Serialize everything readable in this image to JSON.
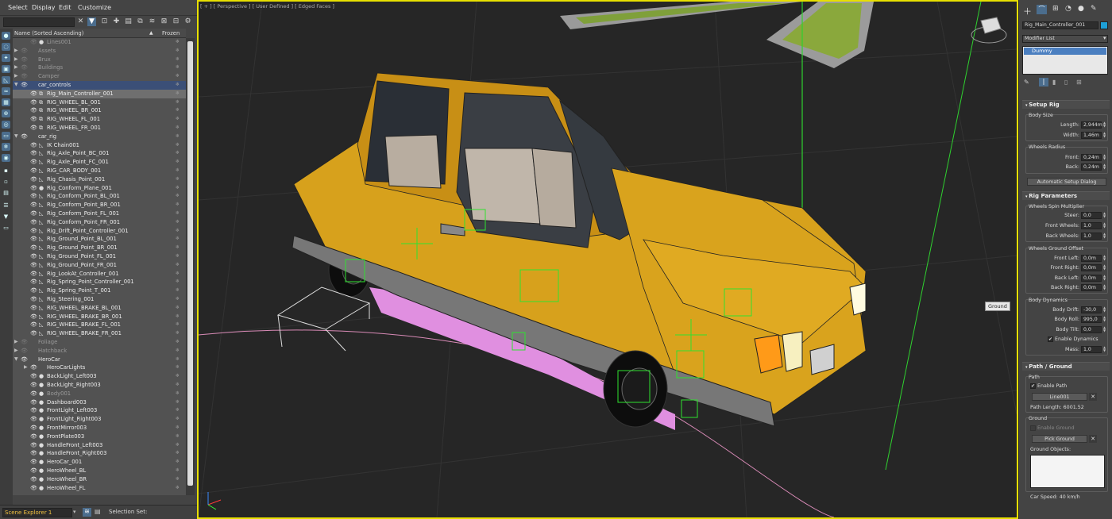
{
  "menubar": {
    "items": [
      "Select",
      "Display",
      "Edit",
      "Customize"
    ]
  },
  "scene_explorer": {
    "header": {
      "name_col": "Name (Sorted Ascending)",
      "frozen_col": "Frozen"
    },
    "rows": [
      {
        "label": "Lines001",
        "level": 2,
        "eye": false,
        "type": "dot",
        "expand": "",
        "dim": true
      },
      {
        "label": "Assets",
        "level": 0,
        "eye": false,
        "type": "",
        "expand": "right",
        "dim": true
      },
      {
        "label": "Brux",
        "level": 0,
        "eye": false,
        "type": "",
        "expand": "right",
        "dim": true
      },
      {
        "label": "Buildings",
        "level": 0,
        "eye": false,
        "type": "",
        "expand": "right",
        "dim": true
      },
      {
        "label": "Camper",
        "level": 0,
        "eye": false,
        "type": "",
        "expand": "right",
        "dim": true
      },
      {
        "label": "car_controls",
        "level": 0,
        "eye": true,
        "type": "",
        "expand": "down",
        "dim": false,
        "cur": true
      },
      {
        "label": "Rig_Main_Controller_001",
        "level": 1,
        "eye": true,
        "type": "helper",
        "expand": "",
        "dim": false,
        "sel": true
      },
      {
        "label": "RIG_WHEEL_BL_001",
        "level": 1,
        "eye": true,
        "type": "helper",
        "expand": "",
        "dim": false
      },
      {
        "label": "RIG_WHEEL_BR_001",
        "level": 1,
        "eye": true,
        "type": "helper",
        "expand": "",
        "dim": false
      },
      {
        "label": "RIG_WHEEL_FL_001",
        "level": 1,
        "eye": true,
        "type": "helper",
        "expand": "",
        "dim": false
      },
      {
        "label": "RIG_WHEEL_FR_001",
        "level": 1,
        "eye": true,
        "type": "helper",
        "expand": "",
        "dim": false
      },
      {
        "label": "car_rig",
        "level": 0,
        "eye": true,
        "type": "",
        "expand": "down",
        "dim": false
      },
      {
        "label": "IK Chain001",
        "level": 1,
        "eye": true,
        "type": "tri",
        "expand": "",
        "dim": false
      },
      {
        "label": "Rig_Axle_Point_BC_001",
        "level": 1,
        "eye": true,
        "type": "tri",
        "expand": "",
        "dim": false
      },
      {
        "label": "Rig_Axle_Point_FC_001",
        "level": 1,
        "eye": true,
        "type": "tri",
        "expand": "",
        "dim": false
      },
      {
        "label": "RIG_CAR_BODY_001",
        "level": 1,
        "eye": true,
        "type": "tri",
        "expand": "",
        "dim": false
      },
      {
        "label": "Rig_Chasis_Point_001",
        "level": 1,
        "eye": true,
        "type": "tri",
        "expand": "",
        "dim": false
      },
      {
        "label": "Rig_Conform_Plane_001",
        "level": 1,
        "eye": true,
        "type": "dot",
        "expand": "",
        "dim": false
      },
      {
        "label": "Rig_Conform_Point_BL_001",
        "level": 1,
        "eye": true,
        "type": "tri",
        "expand": "",
        "dim": false
      },
      {
        "label": "Rig_Conform_Point_BR_001",
        "level": 1,
        "eye": true,
        "type": "tri",
        "expand": "",
        "dim": false
      },
      {
        "label": "Rig_Conform_Point_FL_001",
        "level": 1,
        "eye": true,
        "type": "tri",
        "expand": "",
        "dim": false
      },
      {
        "label": "Rig_Conform_Point_FR_001",
        "level": 1,
        "eye": true,
        "type": "tri",
        "expand": "",
        "dim": false
      },
      {
        "label": "Rig_Drift_Point_Controller_001",
        "level": 1,
        "eye": true,
        "type": "tri",
        "expand": "",
        "dim": false
      },
      {
        "label": "Rig_Ground_Point_BL_001",
        "level": 1,
        "eye": true,
        "type": "tri",
        "expand": "",
        "dim": false
      },
      {
        "label": "Rig_Ground_Point_BR_001",
        "level": 1,
        "eye": true,
        "type": "tri",
        "expand": "",
        "dim": false
      },
      {
        "label": "Rig_Ground_Point_FL_001",
        "level": 1,
        "eye": true,
        "type": "tri",
        "expand": "",
        "dim": false
      },
      {
        "label": "Rig_Ground_Point_FR_001",
        "level": 1,
        "eye": true,
        "type": "tri",
        "expand": "",
        "dim": false
      },
      {
        "label": "Rig_LookAt_Controller_001",
        "level": 1,
        "eye": true,
        "type": "tri",
        "expand": "",
        "dim": false
      },
      {
        "label": "Rig_Spring_Point_Controller_001",
        "level": 1,
        "eye": true,
        "type": "tri",
        "expand": "",
        "dim": false
      },
      {
        "label": "Rig_Spring_Point_T_001",
        "level": 1,
        "eye": true,
        "type": "tri",
        "expand": "",
        "dim": false
      },
      {
        "label": "Rig_Steering_001",
        "level": 1,
        "eye": true,
        "type": "tri",
        "expand": "",
        "dim": false
      },
      {
        "label": "RIG_WHEEL_BRAKE_BL_001",
        "level": 1,
        "eye": true,
        "type": "tri",
        "expand": "",
        "dim": false
      },
      {
        "label": "RIG_WHEEL_BRAKE_BR_001",
        "level": 1,
        "eye": true,
        "type": "tri",
        "expand": "",
        "dim": false
      },
      {
        "label": "RIG_WHEEL_BRAKE_FL_001",
        "level": 1,
        "eye": true,
        "type": "tri",
        "expand": "",
        "dim": false
      },
      {
        "label": "RIG_WHEEL_BRAKE_FR_001",
        "level": 1,
        "eye": true,
        "type": "tri",
        "expand": "",
        "dim": false
      },
      {
        "label": "Foliage",
        "level": 0,
        "eye": false,
        "type": "",
        "expand": "right",
        "dim": true
      },
      {
        "label": "Hatchback",
        "level": 0,
        "eye": false,
        "type": "",
        "expand": "right",
        "dim": true
      },
      {
        "label": "HeroCar",
        "level": 0,
        "eye": true,
        "type": "",
        "expand": "down",
        "dim": false
      },
      {
        "label": "HeroCarLights",
        "level": 1,
        "eye": true,
        "type": "",
        "expand": "right",
        "dim": false
      },
      {
        "label": "BackLight_Left003",
        "level": 1,
        "eye": true,
        "type": "dot",
        "expand": "",
        "dim": false
      },
      {
        "label": "BackLight_Right003",
        "level": 1,
        "eye": true,
        "type": "dot",
        "expand": "",
        "dim": false
      },
      {
        "label": "Body001",
        "level": 1,
        "eye": true,
        "type": "dot",
        "expand": "",
        "dim": true
      },
      {
        "label": "Dashboard003",
        "level": 1,
        "eye": true,
        "type": "dot",
        "expand": "",
        "dim": false
      },
      {
        "label": "FrontLight_Left003",
        "level": 1,
        "eye": true,
        "type": "dot",
        "expand": "",
        "dim": false
      },
      {
        "label": "FrontLight_Right003",
        "level": 1,
        "eye": true,
        "type": "dot",
        "expand": "",
        "dim": false
      },
      {
        "label": "FrontMirror003",
        "level": 1,
        "eye": true,
        "type": "dot",
        "expand": "",
        "dim": false
      },
      {
        "label": "FrontPlate003",
        "level": 1,
        "eye": true,
        "type": "dot",
        "expand": "",
        "dim": false
      },
      {
        "label": "HandleFront_Left003",
        "level": 1,
        "eye": true,
        "type": "dot",
        "expand": "",
        "dim": false
      },
      {
        "label": "HandleFront_Right003",
        "level": 1,
        "eye": true,
        "type": "dot",
        "expand": "",
        "dim": false
      },
      {
        "label": "HeroCar_001",
        "level": 1,
        "eye": true,
        "type": "dot",
        "expand": "",
        "dim": false
      },
      {
        "label": "HeroWheel_BL",
        "level": 1,
        "eye": true,
        "type": "dot",
        "expand": "",
        "dim": false
      },
      {
        "label": "HeroWheel_BR",
        "level": 1,
        "eye": true,
        "type": "dot",
        "expand": "",
        "dim": false
      },
      {
        "label": "HeroWheel_FL",
        "level": 1,
        "eye": true,
        "type": "dot",
        "expand": "",
        "dim": false
      }
    ],
    "bottom": {
      "explorer_name": "Scene Explorer 1",
      "selection_set": "Selection Set:"
    }
  },
  "viewport": {
    "label": "[ + ] [ Perspective ] [ User Defined ] [ Edged Faces ]",
    "tooltip": "Ground"
  },
  "command_panel": {
    "object_name": "Rig_Main_Controller_001",
    "object_color": "#1d9fd6",
    "modifier_list": "Modifier List",
    "stack_item": "Dummy",
    "setup_rig": {
      "title": "Setup Rig",
      "body_size": "Body Size",
      "length_label": "Length:",
      "length_value": "2,944m",
      "width_label": "Width:",
      "width_value": "1,46m",
      "wheels_radius": "Wheels Radius",
      "front_label": "Front:",
      "front_value": "0,24m",
      "back_label": "Back:",
      "back_value": "0,24m",
      "auto_setup": "Automatic Setup Dialog"
    },
    "rig_params": {
      "title": "Rig Parameters",
      "spin_group": "Wheels Spin Multiplier",
      "steer_label": "Steer:",
      "steer_value": "0,0",
      "front_wheels_label": "Front Wheels:",
      "front_wheels_value": "1,0",
      "back_wheels_label": "Back Wheels:",
      "back_wheels_value": "1,0",
      "offset_group": "Wheels Ground Offset",
      "front_left_label": "Front Left:",
      "front_left_value": "0,0m",
      "front_right_label": "Front Right:",
      "front_right_value": "0,0m",
      "back_left_label": "Back Left:",
      "back_left_value": "0,0m",
      "back_right_label": "Back Right:",
      "back_right_value": "0,0m",
      "dynamics_group": "Body Dynamics",
      "drift_label": "Body Drift:",
      "drift_value": "-30,0",
      "roll_label": "Body Roll:",
      "roll_value": "995,0",
      "tilt_label": "Body Tilt:",
      "tilt_value": "0,0",
      "enable_dynamics": "Enable Dynamics",
      "mass_label": "Mass:",
      "mass_value": "1,0"
    },
    "path_ground": {
      "title": "Path / Ground",
      "path_group": "Path",
      "enable_path": "Enable Path",
      "path_object": "Line001",
      "path_length": "Path Length: 6001.52",
      "ground_group": "Ground",
      "enable_ground": "Enable Ground",
      "pick_ground": "Pick Ground",
      "ground_objects": "Ground Objects:",
      "car_speed": "Car Speed: 40 km/h"
    }
  }
}
